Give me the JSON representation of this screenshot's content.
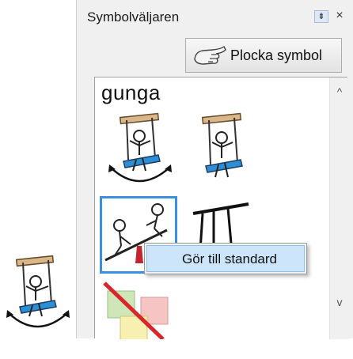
{
  "panel": {
    "title": "Symbolväljaren",
    "pin_glyph": "⇟",
    "close_glyph": "×",
    "pick_button_label": "Plocka symbol",
    "pick_button_icon": "pointing-hand-icon"
  },
  "symbol_list": {
    "search_word": "gunga",
    "scroll_up_glyph": "^",
    "scroll_down_glyph": "v",
    "items": [
      {
        "icon": "swing-arrows-symbol",
        "selected": false
      },
      {
        "icon": "swing-symbol",
        "selected": false
      },
      {
        "icon": "seesaw-symbol",
        "selected": true
      },
      {
        "icon": "swing-frame-symbol",
        "selected": false
      },
      {
        "icon": "no-symbol",
        "selected": false
      }
    ],
    "selected_color": "#3b8fe0"
  },
  "context_menu": {
    "items": [
      {
        "label": "Gör till standard"
      }
    ],
    "highlight_color": "#cce5fb"
  },
  "canvas": {
    "placed_symbol": "swing-arrows-symbol"
  }
}
